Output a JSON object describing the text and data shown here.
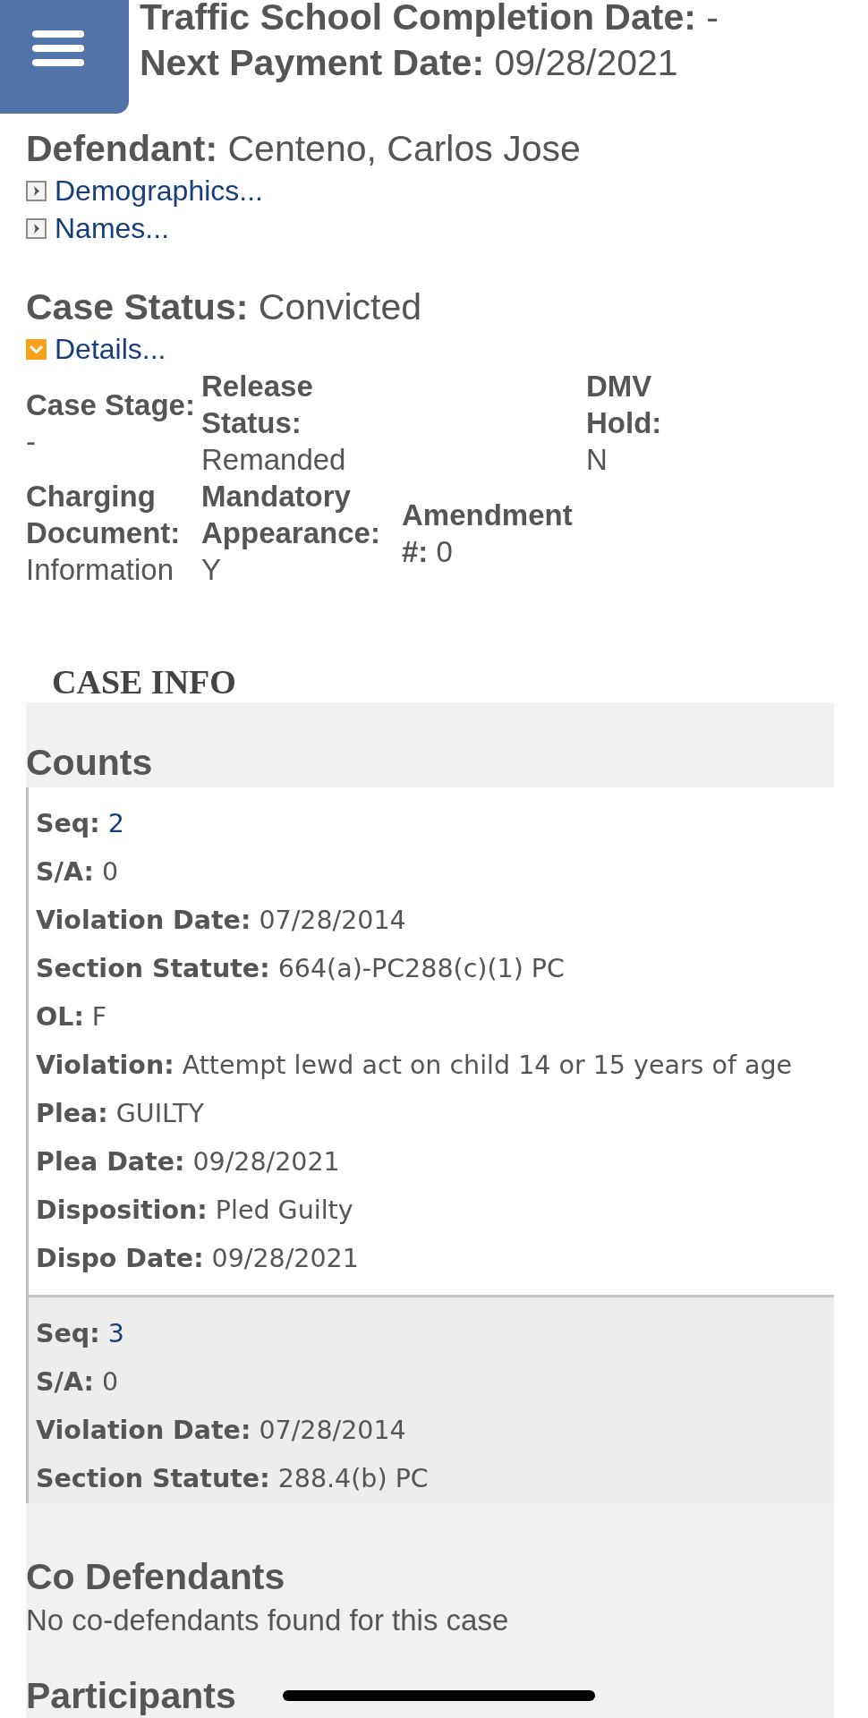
{
  "summary": [
    {
      "label": "Traffic School Completion Date:",
      "value": "-"
    },
    {
      "label": "Next Payment Date:",
      "value": "09/28/2021"
    }
  ],
  "defendant": {
    "label": "Defendant:",
    "value": "Centeno, Carlos Jose",
    "links": [
      {
        "label": "Demographics...",
        "expanded": false
      },
      {
        "label": "Names...",
        "expanded": false
      }
    ]
  },
  "case_status": {
    "label": "Case Status:",
    "value": "Convicted",
    "links": [
      {
        "label": "Details...",
        "expanded": true
      }
    ]
  },
  "details": [
    {
      "label": "Case Stage:",
      "value": "-"
    },
    {
      "label": "Release Status:",
      "value": "Remanded"
    },
    {
      "label": "DMV Hold:",
      "value": "N"
    },
    {
      "label": "Charging Document:",
      "value": "Information"
    },
    {
      "label": "Mandatory Appearance:",
      "value": "Y"
    },
    {
      "label": "Amendment #:",
      "value": "0"
    }
  ],
  "case_info": {
    "title": "CASE INFO",
    "counts": {
      "title": "Counts",
      "items": [
        {
          "fields": [
            {
              "label": "Seq:",
              "value": "2",
              "kind": "link"
            },
            {
              "label": "S/A:",
              "value": "0",
              "kind": "text"
            },
            {
              "label": "Violation Date:",
              "value": "07/28/2014",
              "kind": "text"
            },
            {
              "label": "Section Statute:",
              "value": "664(a)-PC288(c)(1) PC",
              "kind": "text"
            },
            {
              "label": "OL:",
              "value": "F",
              "kind": "text"
            },
            {
              "label": "Violation:",
              "value": "Attempt lewd act on child 14 or 15 years of age",
              "kind": "text"
            },
            {
              "label": "Plea:",
              "value": "GUILTY",
              "kind": "text"
            },
            {
              "label": "Plea Date:",
              "value": "09/28/2021",
              "kind": "text"
            },
            {
              "label": "Disposition:",
              "value": "Pled Guilty",
              "kind": "text"
            },
            {
              "label": "Dispo Date:",
              "value": "09/28/2021",
              "kind": "text"
            }
          ]
        },
        {
          "fields": [
            {
              "label": "Seq:",
              "value": "3",
              "kind": "link"
            },
            {
              "label": "S/A:",
              "value": "0",
              "kind": "text"
            },
            {
              "label": "Violation Date:",
              "value": "07/28/2014",
              "kind": "text"
            },
            {
              "label": "Section Statute:",
              "value": "288.4(b) PC",
              "kind": "text"
            }
          ]
        }
      ]
    },
    "co_defendants": {
      "title": "Co Defendants",
      "message": "No co-defendants found for this case"
    },
    "participants": {
      "title": "Participants"
    }
  }
}
